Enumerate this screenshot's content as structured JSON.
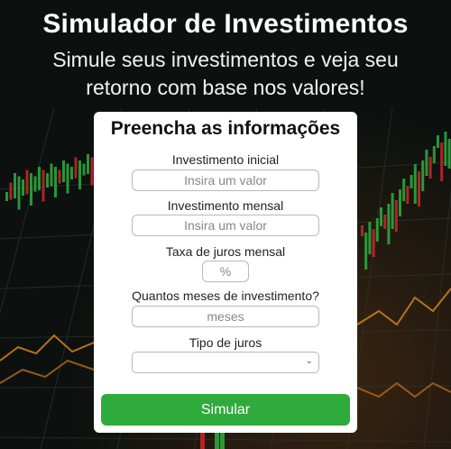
{
  "hero": {
    "title": "Simulador de Investimentos",
    "subtitle": "Simule seus investimentos e veja seu retorno com base nos valores!"
  },
  "form": {
    "heading": "Preencha as informações",
    "initial_investment": {
      "label": "Investimento inicial",
      "placeholder": "Insira um valor",
      "value": ""
    },
    "monthly_investment": {
      "label": "Investimento mensal",
      "placeholder": "Insira um valor",
      "value": ""
    },
    "monthly_rate": {
      "label": "Taxa de juros mensal",
      "placeholder": "%",
      "value": ""
    },
    "months": {
      "label": "Quantos meses de investimento?",
      "placeholder": "meses",
      "value": ""
    },
    "interest_type": {
      "label": "Tipo de juros",
      "selected": ""
    },
    "submit_label": "Simular"
  },
  "colors": {
    "button": "#2faa3c",
    "candle_up": "#2fae3f",
    "candle_down": "#c9282d",
    "line_orange": "#e0891f"
  }
}
